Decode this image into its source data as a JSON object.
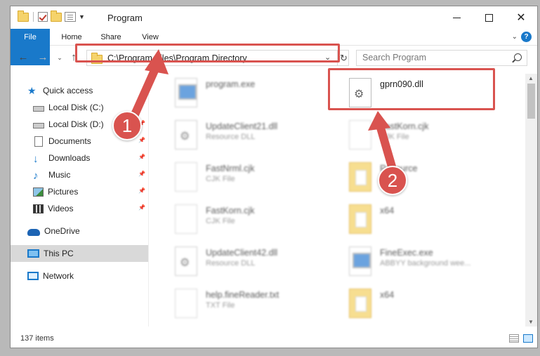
{
  "window": {
    "title": "Program",
    "status": "137 items"
  },
  "ribbon": {
    "tabs": [
      "File",
      "Home",
      "Share",
      "View"
    ]
  },
  "address": {
    "path": "C:\\Program Files\\Program Directory",
    "search_placeholder": "Search Program"
  },
  "sidebar": {
    "items": [
      {
        "label": "Quick access",
        "icon": "star-icon",
        "pinned": false
      },
      {
        "label": "Local Disk (C:)",
        "icon": "disk-icon",
        "pinned": false
      },
      {
        "label": "Local Disk (D:)",
        "icon": "disk-icon",
        "pinned": true
      },
      {
        "label": "Documents",
        "icon": "document-icon",
        "pinned": true
      },
      {
        "label": "Downloads",
        "icon": "download-icon",
        "pinned": true
      },
      {
        "label": "Music",
        "icon": "music-icon",
        "pinned": true
      },
      {
        "label": "Pictures",
        "icon": "pictures-icon",
        "pinned": true
      },
      {
        "label": "Videos",
        "icon": "videos-icon",
        "pinned": true
      },
      {
        "label": "OneDrive",
        "icon": "cloud-icon",
        "pinned": false
      },
      {
        "label": "This PC",
        "icon": "computer-icon",
        "pinned": false,
        "selected": true
      },
      {
        "label": "Network",
        "icon": "network-icon",
        "pinned": false
      }
    ]
  },
  "files": [
    {
      "name": "program.exe",
      "type": "",
      "icon": "exe-icon"
    },
    {
      "name": "gprn090.dll",
      "type": "",
      "icon": "dll-icon"
    },
    {
      "name": "UpdateClient21.dll",
      "type": "Resource DLL",
      "icon": "dll-icon"
    },
    {
      "name": "FastKorn.cjk",
      "type": "CJK File",
      "icon": "file-icon"
    },
    {
      "name": "FastNrml.cjk",
      "type": "CJK File",
      "icon": "file-icon"
    },
    {
      "name": "Resource",
      "type": "",
      "icon": "folder-icon"
    },
    {
      "name": "FastKorn.cjk",
      "type": "CJK File",
      "icon": "file-icon"
    },
    {
      "name": "x64",
      "type": "",
      "icon": "folder-icon"
    },
    {
      "name": "UpdateClient42.dll",
      "type": "Resource DLL",
      "icon": "dll-icon"
    },
    {
      "name": "FineExec.exe",
      "type": "ABBYY background wee...",
      "icon": "exe-icon"
    },
    {
      "name": "help.fineReader.txt",
      "type": "TXT File",
      "icon": "file-icon"
    },
    {
      "name": "x64",
      "type": "",
      "icon": "folder-icon"
    }
  ],
  "annotations": {
    "step1": "1",
    "step2": "2",
    "color": "#d9534f"
  }
}
